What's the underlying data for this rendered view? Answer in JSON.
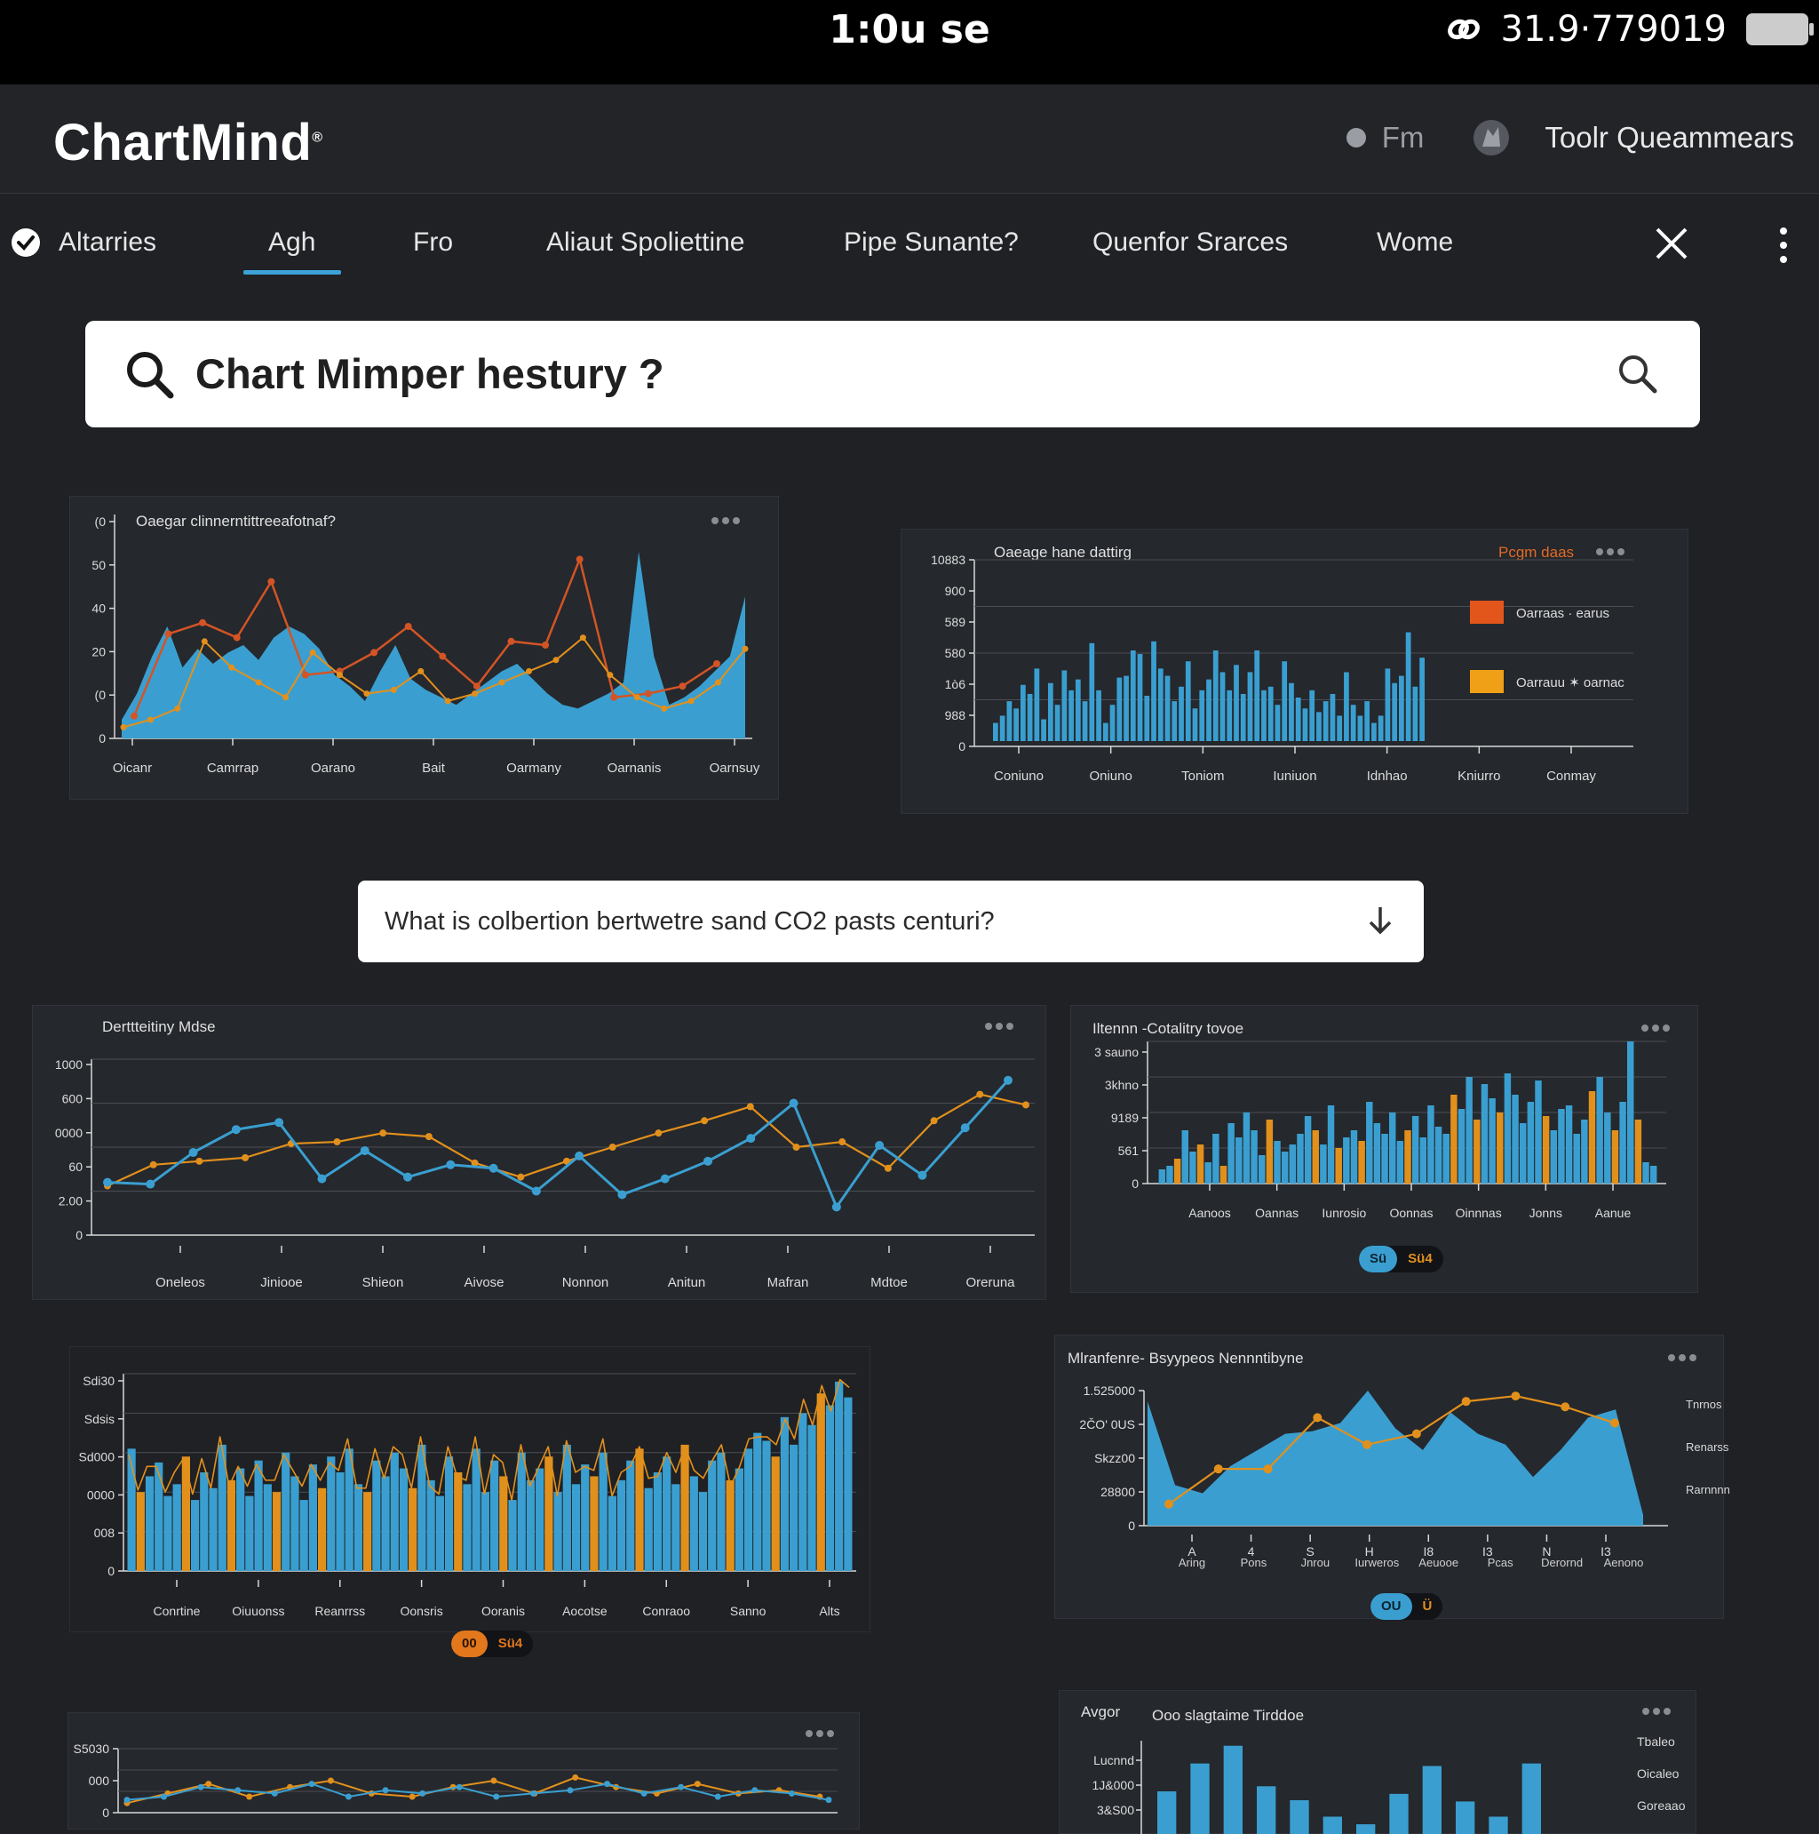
{
  "status": {
    "time": "1:0u se",
    "info": "31.9·779019"
  },
  "app": {
    "name": "ChartMind",
    "mark": "®",
    "link1": "Fm",
    "user": "Toolr Queammears"
  },
  "nav": {
    "tabs": [
      "Altarries",
      "Agh",
      "Fro",
      "Aliaut Spoliettine",
      "Pipe Sunante?",
      "Quenfor Srarces",
      "Wome"
    ],
    "active_index": 1
  },
  "search": {
    "query": "Chart Mimper hestury ?"
  },
  "question": {
    "text": "What is colbertion bertwetre sand CO2 pasts centuri?"
  },
  "colors": {
    "blue": "#3a9fd0",
    "orange": "#e2901c",
    "red": "#d35425",
    "accent": "#3da2d6"
  },
  "chart_data": [
    {
      "type": "area",
      "title": "Oaegar clinnerntittreeafotnaf?",
      "ylim": [
        0,
        60
      ],
      "yticks": [
        "0",
        "(0",
        "20",
        "40",
        "50",
        "(0"
      ],
      "xticks": [
        "Oicanr",
        "Camrrap",
        "Oarano",
        "Bait",
        "Oarmany",
        "Oarnanis",
        "Oarnsuy"
      ],
      "series": [
        {
          "name": "",
          "kind": "area",
          "values": [
            5,
            12,
            22,
            30,
            19,
            24,
            20,
            23,
            25,
            21,
            27,
            30,
            28,
            24,
            17,
            14,
            10,
            18,
            25,
            16,
            13,
            11,
            9,
            12,
            15,
            18,
            20,
            16,
            12,
            9,
            8,
            10,
            12,
            15,
            50,
            22,
            9,
            11,
            14,
            18,
            22,
            38
          ]
        },
        {
          "name": "",
          "kind": "line",
          "values": [
            6,
            28,
            31,
            27,
            42,
            17,
            18,
            23,
            30,
            22,
            14,
            26,
            25,
            48,
            11,
            12,
            14,
            20
          ]
        },
        {
          "name": "",
          "kind": "line",
          "values": [
            3,
            5,
            8,
            26,
            19,
            15,
            11,
            23,
            17,
            12,
            13,
            18,
            10,
            12,
            15,
            18,
            21,
            27,
            17,
            11,
            8,
            10,
            15,
            24
          ]
        }
      ]
    },
    {
      "type": "bar",
      "title": "Oaeage hane dattirg",
      "ylim": [
        0,
        100
      ],
      "yticks": [
        "0",
        "988",
        "1ò6",
        "580",
        "589",
        "900",
        "10883"
      ],
      "xticks": [
        "Coniuno",
        "Oniuno",
        "Toniom",
        "Iuniuon",
        "Idnhao",
        "Kniurro",
        "Conmay"
      ],
      "legend": {
        "title": "Pcgm daas",
        "position": "right",
        "items": [
          "Oarraas · earus",
          "Oarrauu ✶ oarnac"
        ]
      },
      "values": [
        10,
        14,
        22,
        18,
        31,
        26,
        40,
        12,
        32,
        20,
        39,
        28,
        34,
        22,
        54,
        28,
        10,
        20,
        35,
        36,
        50,
        48,
        25,
        55,
        40,
        36,
        22,
        30,
        44,
        18,
        28,
        34,
        50,
        38,
        28,
        42,
        26,
        38,
        50,
        28,
        30,
        20,
        44,
        32,
        24,
        18,
        28,
        16,
        22,
        26,
        14,
        38,
        20,
        14,
        22,
        10,
        14,
        40,
        32,
        36,
        60,
        30,
        46
      ]
    },
    {
      "type": "line",
      "title": "Derttteitiny Mdse",
      "yticks": [
        "0",
        "2.00",
        "60",
        "0000",
        "600",
        "1000"
      ],
      "xticks": [
        "Oneleos",
        "Jiniooe",
        "Shieon",
        "Aivose",
        "Nonnon",
        "Anitun",
        "Mafran",
        "Mdtoe",
        "Oreruna"
      ],
      "series": [
        {
          "name": "",
          "color": "blue",
          "values": [
            30,
            29,
            47,
            60,
            64,
            32,
            48,
            33,
            40,
            38,
            25,
            45,
            23,
            32,
            42,
            55,
            75,
            16,
            51,
            34,
            61,
            88
          ]
        },
        {
          "name": "",
          "color": "orange",
          "values": [
            28,
            40,
            42,
            44,
            52,
            53,
            58,
            56,
            41,
            33,
            42,
            50,
            58,
            65,
            73,
            50,
            53,
            38,
            65,
            80,
            74
          ]
        }
      ]
    },
    {
      "type": "bar",
      "title": "Iltennn  -Cotalitry tovoe",
      "yticks": [
        "0",
        "561",
        "9189",
        "3khno",
        "3 sauno"
      ],
      "xticks": [
        "Aanoos",
        "Oannas",
        "Iunrosio",
        "Oonnas",
        "Oinnnas",
        "Jonns",
        "Aanue"
      ],
      "pill": [
        "Sü",
        "Sü4"
      ],
      "values": [
        8,
        10,
        14,
        30,
        18,
        22,
        12,
        28,
        10,
        34,
        26,
        40,
        30,
        16,
        36,
        24,
        18,
        22,
        28,
        38,
        30,
        22,
        44,
        20,
        26,
        30,
        24,
        46,
        34,
        28,
        40,
        24,
        30,
        38,
        26,
        44,
        32,
        28,
        50,
        42,
        60,
        36,
        56,
        48,
        40,
        62,
        50,
        34,
        46,
        58,
        38,
        30,
        42,
        44,
        28,
        36,
        52,
        60,
        40,
        30,
        46,
        80,
        36,
        12,
        10
      ]
    },
    {
      "type": "bar",
      "title": "",
      "yticks": [
        "0",
        "008",
        "0000",
        "Sd000",
        "Sdsis",
        "Sdi30"
      ],
      "xticks": [
        "Conrtine",
        "Oiuuonss",
        "Reanrrss",
        "Oonsris",
        "Ooranis",
        "Aocotse",
        "Conraoo",
        "Sanno",
        "Alts"
      ],
      "pill": [
        "00",
        "Sü4"
      ],
      "values": [
        62,
        40,
        48,
        55,
        38,
        44,
        58,
        36,
        50,
        42,
        64,
        46,
        52,
        38,
        56,
        44,
        40,
        60,
        48,
        36,
        54,
        42,
        58,
        50,
        62,
        44,
        40,
        56,
        48,
        60,
        52,
        42,
        64,
        46,
        38,
        58,
        50,
        44,
        62,
        40,
        56,
        48,
        36,
        60,
        46,
        52,
        58,
        40,
        64,
        44,
        54,
        48,
        60,
        38,
        46,
        56,
        62,
        42,
        50,
        58,
        44,
        64,
        48,
        40,
        56,
        60,
        46,
        52,
        62,
        70,
        66,
        58,
        78,
        64,
        80,
        74,
        90,
        84,
        96,
        88
      ]
    },
    {
      "type": "area",
      "title": "Mlranfenre-  Bsyypeos Nennntibyne",
      "yticks": [
        "0",
        "28800",
        "Skzz00",
        "2ČO' 0US",
        "1.525000"
      ],
      "xticks": [
        "A",
        "4",
        "S",
        "H",
        "I8",
        "I3",
        "N",
        "I3"
      ],
      "xsub": [
        "Aring",
        "Pons",
        "Jnrou",
        "Iurweros",
        "Aeuooe",
        "Pcas",
        "Derornd",
        "Aenono"
      ],
      "legend": {
        "position": "right",
        "items": [
          "Tnrnos",
          "Renarss",
          "Rarnnnn"
        ]
      },
      "pill": [
        "OU",
        "Ü"
      ],
      "series": [
        {
          "name": "",
          "kind": "area",
          "values": [
            4,
            35,
            38,
            28,
            22,
            16,
            15,
            12,
            0,
            14,
            22,
            8,
            16,
            20,
            32,
            22,
            10,
            7,
            46
          ]
        },
        {
          "name": "",
          "kind": "line",
          "values": [
            0,
            25,
            25,
            31,
            32,
            33,
            20,
            18,
            30,
            5
          ]
        }
      ]
    },
    {
      "type": "line",
      "title": "",
      "yticks": [
        "0",
        "000",
        "S5030"
      ],
      "xticks": [],
      "series": [
        {
          "name": "",
          "color": "blue",
          "values": [
            8,
            10,
            16,
            14,
            12,
            18,
            10,
            14,
            12,
            16,
            10,
            12,
            14,
            18,
            12,
            16,
            10,
            14,
            12,
            8
          ]
        },
        {
          "name": "",
          "color": "orange",
          "values": [
            6,
            12,
            18,
            10,
            16,
            20,
            12,
            10,
            16,
            20,
            12,
            22,
            16,
            12,
            18,
            12,
            14,
            10
          ]
        }
      ]
    },
    {
      "type": "bar",
      "title": "Ooo slagtaime Tirddoe",
      "subtitle": "Avgor",
      "yticks": [
        "3&S00",
        "1J&000",
        "Lucnnd"
      ],
      "legend": {
        "position": "right",
        "items": [
          "Tbaleo",
          "Oicaleo",
          "Goreaao"
        ]
      },
      "values": [
        40,
        62,
        76,
        44,
        33,
        20,
        14,
        38,
        60,
        32,
        20,
        62
      ]
    }
  ]
}
